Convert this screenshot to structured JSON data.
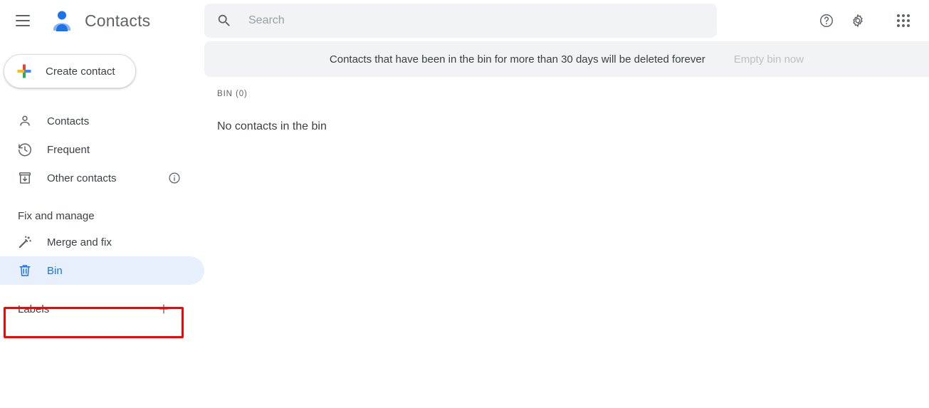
{
  "header": {
    "menu_icon": "hamburger-menu-icon",
    "logo_icon": "google-contacts-logo-icon",
    "title": "Contacts",
    "help_icon": "help-circle-icon",
    "settings_icon": "gear-icon",
    "apps_icon": "apps-grid-icon"
  },
  "search": {
    "icon": "search-icon",
    "placeholder": "Search",
    "value": ""
  },
  "sidebar": {
    "create_button": {
      "icon": "google-plus-multicolor-icon",
      "label": "Create contact"
    },
    "items": [
      {
        "icon": "person-icon",
        "label": "Contacts",
        "selected": false
      },
      {
        "icon": "history-clock-icon",
        "label": "Frequent",
        "selected": false
      },
      {
        "icon": "archive-down-arrow-icon",
        "label": "Other contacts",
        "selected": false,
        "trailing_icon": "info-circle-icon"
      }
    ],
    "section_title": "Fix and manage",
    "manage_items": [
      {
        "icon": "magic-wand-icon",
        "label": "Merge and fix",
        "selected": false
      },
      {
        "icon": "trash-bin-icon",
        "label": "Bin",
        "selected": true
      }
    ],
    "labels": {
      "title": "Labels",
      "add_icon": "plus-icon"
    }
  },
  "main": {
    "banner": {
      "message": "Contacts that have been in the bin for more than 30 days will be deleted forever",
      "action_label": "Empty bin now",
      "action_disabled": true
    },
    "list_header": "BIN (0)",
    "empty_message": "No contacts in the bin"
  },
  "colors": {
    "accent_blue": "#1a73e8",
    "selected_bg": "#e8f0fe",
    "banner_bg": "#f1f3f4",
    "annotation_red": "#ff0000",
    "text_primary": "#3c4043",
    "text_secondary": "#5f6368",
    "text_disabled": "#bdc1c6"
  }
}
